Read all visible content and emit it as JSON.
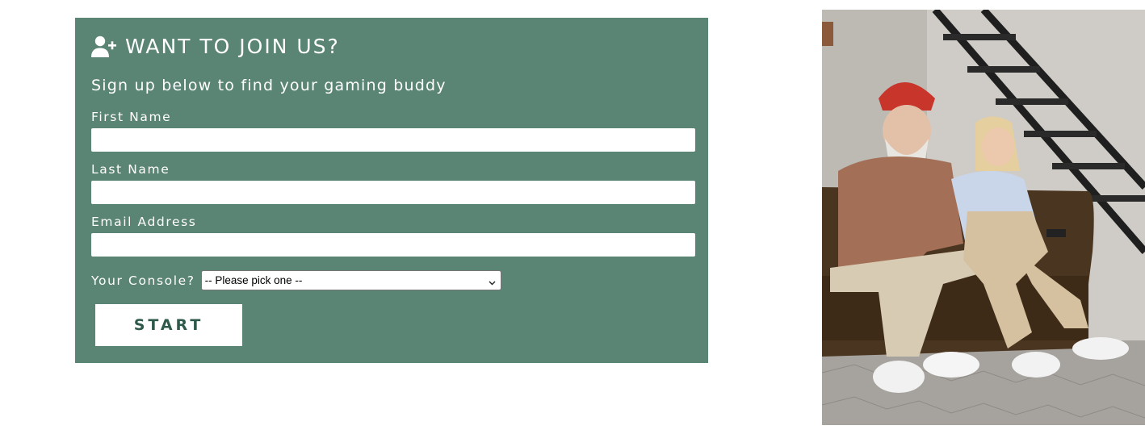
{
  "signup": {
    "icon": "user-plus-icon",
    "title": "WANT TO JOIN US?",
    "subtitle": "Sign up below to find your gaming buddy",
    "first_name_label": "First Name",
    "first_name_value": "",
    "last_name_label": "Last Name",
    "last_name_value": "",
    "email_label": "Email Address",
    "email_value": "",
    "console_label": "Your Console?",
    "console_selected": "-- Please pick one --",
    "submit_label": "START"
  },
  "colors": {
    "panel_bg": "#5a8474",
    "button_text": "#2f5a4b",
    "text": "#ffffff"
  },
  "photo": {
    "subject": "two seniors playing video games on a sofa"
  }
}
